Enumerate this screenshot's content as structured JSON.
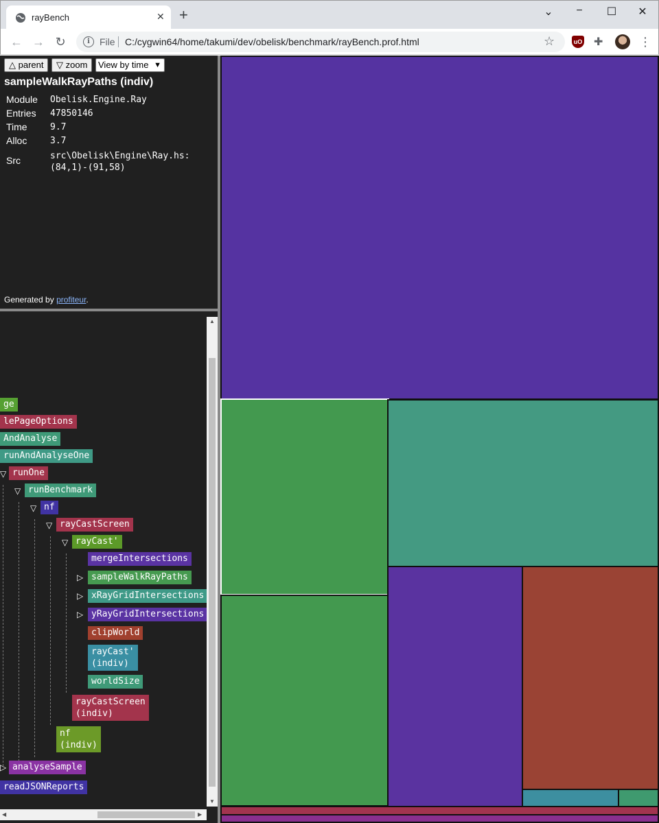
{
  "browser": {
    "tab_title": "rayBench",
    "new_tab_symbol": "+",
    "address_scheme_label": "File",
    "address_url": "C:/cygwin64/home/takumi/dev/obelisk/benchmark/rayBench.prof.html",
    "extension_ublock_label": "uO"
  },
  "panel": {
    "parent_button": "△ parent",
    "zoom_button": "▽ zoom",
    "view_select": "View by time",
    "function_title": "sampleWalkRayPaths (indiv)",
    "info": {
      "module_label": "Module",
      "module_value": "Obelisk.Engine.Ray",
      "entries_label": "Entries",
      "entries_value": "47850146",
      "time_label": "Time",
      "time_value": "9.7",
      "alloc_label": "Alloc",
      "alloc_value": "3.7",
      "src_label": "Src",
      "src_value_line1": "src\\Obelisk\\Engine\\Ray.hs:",
      "src_value_line2": "(84,1)-(91,58)"
    },
    "generated_prefix": "Generated by ",
    "generated_link": "profiteur",
    "generated_suffix": "."
  },
  "tree": {
    "nodes": [
      {
        "label": "ge",
        "color": "#56a032"
      },
      {
        "label": "lePageOptions",
        "color": "#a3344c"
      },
      {
        "label": "AndAnalyse",
        "color": "#3f9a78"
      },
      {
        "label": "runAndAnalyseOne",
        "color": "#3f9a86"
      },
      {
        "label": "runOne",
        "color": "#a3344c"
      },
      {
        "label": "runBenchmark",
        "color": "#3f9a78"
      },
      {
        "label": "nf",
        "color": "#4033a3"
      },
      {
        "label": "rayCastScreen",
        "color": "#a3344c"
      },
      {
        "label": "rayCast'",
        "color": "#5c9a28"
      },
      {
        "label": "mergeIntersections",
        "color": "#5a33a3"
      },
      {
        "label": "sampleWalkRayPaths",
        "color": "#469a50"
      },
      {
        "label": "xRayGridIntersections",
        "color": "#3f9a88"
      },
      {
        "label": "yRayGridIntersections",
        "color": "#5a33a3"
      },
      {
        "label": "clipWorld",
        "color": "#a0402e"
      },
      {
        "label": "rayCast'\n(indiv)",
        "color": "#3a8fa3"
      },
      {
        "label": "worldSize",
        "color": "#3f9a78"
      },
      {
        "label": "rayCastScreen\n(indiv)",
        "color": "#a3344c"
      },
      {
        "label": "nf\n(indiv)",
        "color": "#6c9a28"
      },
      {
        "label": "analyseSample",
        "color": "#8a33a3"
      },
      {
        "label": "readJSONReports",
        "color": "#4033a3"
      }
    ],
    "expand_symbol": "▽",
    "collapsed_symbol": "▷"
  },
  "treemap": {
    "colors": {
      "purple": "#5533a1",
      "green": "#43994f",
      "teal": "#449a82",
      "violet": "#5a33a0",
      "rust": "#9a4334",
      "cyan": "#3d8fa0",
      "sea": "#3f9a6f",
      "maroon": "#a2344f",
      "magenta": "#8a2f8f"
    }
  }
}
